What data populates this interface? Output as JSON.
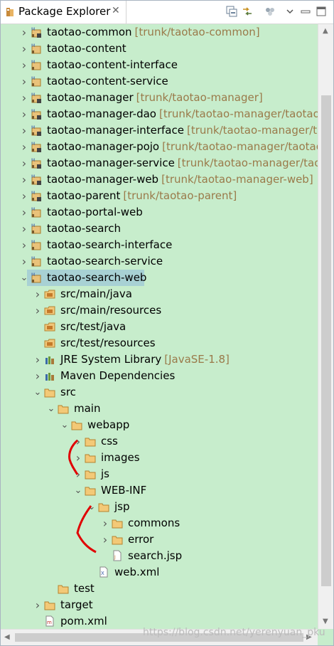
{
  "view": {
    "title": "Package Explorer",
    "close_glyph": "✕"
  },
  "toolbar": {
    "collapse_all": "collapse-all-icon",
    "link_with_editor": "link-with-editor-icon",
    "focus": "focus-icon",
    "view_menu": "view-menu-icon",
    "minimize": "minimize-icon",
    "maximize": "maximize-icon"
  },
  "tree": [
    {
      "label": "taotao-common",
      "decoration": "[trunk/taotao-common]",
      "depth": 0,
      "arrow": "collapsed",
      "icon": "maven-project-svn"
    },
    {
      "label": "taotao-content",
      "decoration": "",
      "depth": 0,
      "arrow": "collapsed",
      "icon": "maven-project"
    },
    {
      "label": "taotao-content-interface",
      "decoration": "",
      "depth": 0,
      "arrow": "collapsed",
      "icon": "maven-project"
    },
    {
      "label": "taotao-content-service",
      "decoration": "",
      "depth": 0,
      "arrow": "collapsed",
      "icon": "maven-project"
    },
    {
      "label": "taotao-manager",
      "decoration": "[trunk/taotao-manager]",
      "depth": 0,
      "arrow": "collapsed",
      "icon": "maven-project-svn"
    },
    {
      "label": "taotao-manager-dao",
      "decoration": "[trunk/taotao-manager/taotao-",
      "depth": 0,
      "arrow": "collapsed",
      "icon": "maven-project-svn"
    },
    {
      "label": "taotao-manager-interface",
      "decoration": "[trunk/taotao-manager/tao",
      "depth": 0,
      "arrow": "collapsed",
      "icon": "maven-project-svn"
    },
    {
      "label": "taotao-manager-pojo",
      "decoration": "[trunk/taotao-manager/taotao",
      "depth": 0,
      "arrow": "collapsed",
      "icon": "maven-project-svn"
    },
    {
      "label": "taotao-manager-service",
      "decoration": "[trunk/taotao-manager/taot",
      "depth": 0,
      "arrow": "collapsed",
      "icon": "maven-project-svn"
    },
    {
      "label": "taotao-manager-web",
      "decoration": "[trunk/taotao-manager-web]",
      "depth": 0,
      "arrow": "collapsed",
      "icon": "maven-project-svn"
    },
    {
      "label": "taotao-parent",
      "decoration": "[trunk/taotao-parent]",
      "depth": 0,
      "arrow": "collapsed",
      "icon": "maven-project-svn"
    },
    {
      "label": "taotao-portal-web",
      "decoration": "",
      "depth": 0,
      "arrow": "collapsed",
      "icon": "maven-project"
    },
    {
      "label": "taotao-search",
      "decoration": "",
      "depth": 0,
      "arrow": "collapsed",
      "icon": "maven-project"
    },
    {
      "label": "taotao-search-interface",
      "decoration": "",
      "depth": 0,
      "arrow": "collapsed",
      "icon": "maven-project"
    },
    {
      "label": "taotao-search-service",
      "decoration": "",
      "depth": 0,
      "arrow": "collapsed",
      "icon": "maven-project"
    },
    {
      "label": "taotao-search-web",
      "decoration": "",
      "depth": 0,
      "arrow": "expanded",
      "icon": "maven-project",
      "selected": true
    },
    {
      "label": "src/main/java",
      "decoration": "",
      "depth": 1,
      "arrow": "collapsed",
      "icon": "source-folder"
    },
    {
      "label": "src/main/resources",
      "decoration": "",
      "depth": 1,
      "arrow": "collapsed",
      "icon": "source-folder"
    },
    {
      "label": "src/test/java",
      "decoration": "",
      "depth": 1,
      "arrow": "none",
      "icon": "source-folder"
    },
    {
      "label": "src/test/resources",
      "decoration": "",
      "depth": 1,
      "arrow": "none",
      "icon": "source-folder"
    },
    {
      "label": "JRE System Library",
      "decoration": "[JavaSE-1.8]",
      "depth": 1,
      "arrow": "collapsed",
      "icon": "library"
    },
    {
      "label": "Maven Dependencies",
      "decoration": "",
      "depth": 1,
      "arrow": "collapsed",
      "icon": "library"
    },
    {
      "label": "src",
      "decoration": "",
      "depth": 1,
      "arrow": "expanded",
      "icon": "folder"
    },
    {
      "label": "main",
      "decoration": "",
      "depth": 2,
      "arrow": "expanded",
      "icon": "folder"
    },
    {
      "label": "webapp",
      "decoration": "",
      "depth": 3,
      "arrow": "expanded",
      "icon": "folder"
    },
    {
      "label": "css",
      "decoration": "",
      "depth": 4,
      "arrow": "collapsed",
      "icon": "folder"
    },
    {
      "label": "images",
      "decoration": "",
      "depth": 4,
      "arrow": "collapsed",
      "icon": "folder"
    },
    {
      "label": "js",
      "decoration": "",
      "depth": 4,
      "arrow": "collapsed",
      "icon": "folder"
    },
    {
      "label": "WEB-INF",
      "decoration": "",
      "depth": 4,
      "arrow": "expanded",
      "icon": "folder"
    },
    {
      "label": "jsp",
      "decoration": "",
      "depth": 5,
      "arrow": "expanded",
      "icon": "folder"
    },
    {
      "label": "commons",
      "decoration": "",
      "depth": 6,
      "arrow": "collapsed",
      "icon": "folder"
    },
    {
      "label": "error",
      "decoration": "",
      "depth": 6,
      "arrow": "collapsed",
      "icon": "folder"
    },
    {
      "label": "search.jsp",
      "decoration": "",
      "depth": 6,
      "arrow": "none",
      "icon": "jsp-file"
    },
    {
      "label": "web.xml",
      "decoration": "",
      "depth": 5,
      "arrow": "none",
      "icon": "xml-file"
    },
    {
      "label": "test",
      "decoration": "",
      "depth": 2,
      "arrow": "none",
      "icon": "folder"
    },
    {
      "label": "target",
      "decoration": "",
      "depth": 1,
      "arrow": "collapsed",
      "icon": "folder"
    },
    {
      "label": "pom.xml",
      "decoration": "",
      "depth": 1,
      "arrow": "none",
      "icon": "pom-file"
    }
  ],
  "watermark": "https://blog.csdn.net/yerenyuan_pku"
}
